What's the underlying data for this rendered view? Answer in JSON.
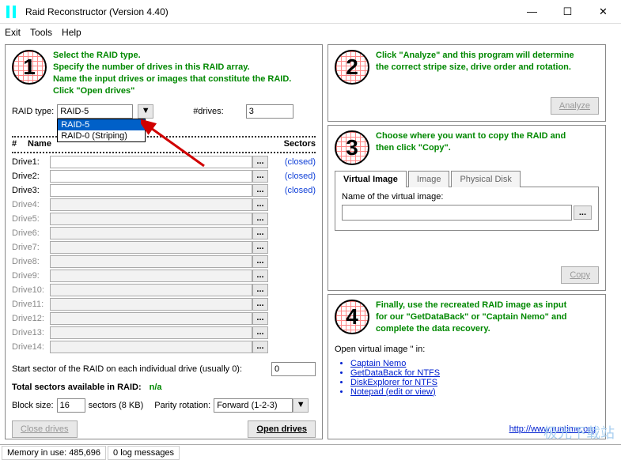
{
  "window": {
    "title": "Raid Reconstructor (Version 4.40)",
    "min": "—",
    "max": "☐",
    "close": "✕"
  },
  "menu": {
    "exit": "Exit",
    "tools": "Tools",
    "help": "Help"
  },
  "step1": {
    "num": "1",
    "line1": "Select the RAID type.",
    "line2": "Specify the number of drives in this RAID array.",
    "line3": "Name the input drives or images that constitute the RAID.",
    "line4": "Click \"Open drives\""
  },
  "raidtype_label": "RAID type:",
  "raidtype_value": "RAID-5",
  "raidtype_options": {
    "opt1": "RAID-5",
    "opt2": "RAID-0 (Striping)"
  },
  "drives_label": "#drives:",
  "drives_value": "3",
  "table": {
    "col_num": "#",
    "col_name": "Name",
    "col_sectors": "Sectors",
    "rows": [
      {
        "label": "Drive1:",
        "status": "(closed)",
        "en": true
      },
      {
        "label": "Drive2:",
        "status": "(closed)",
        "en": true
      },
      {
        "label": "Drive3:",
        "status": "(closed)",
        "en": true
      },
      {
        "label": "Drive4:",
        "status": "",
        "en": false
      },
      {
        "label": "Drive5:",
        "status": "",
        "en": false
      },
      {
        "label": "Drive6:",
        "status": "",
        "en": false
      },
      {
        "label": "Drive7:",
        "status": "",
        "en": false
      },
      {
        "label": "Drive8:",
        "status": "",
        "en": false
      },
      {
        "label": "Drive9:",
        "status": "",
        "en": false
      },
      {
        "label": "Drive10:",
        "status": "",
        "en": false
      },
      {
        "label": "Drive11:",
        "status": "",
        "en": false
      },
      {
        "label": "Drive12:",
        "status": "",
        "en": false
      },
      {
        "label": "Drive13:",
        "status": "",
        "en": false
      },
      {
        "label": "Drive14:",
        "status": "",
        "en": false
      }
    ]
  },
  "start_sector_label": "Start sector of the RAID on each individual drive (usually 0):",
  "start_sector_value": "0",
  "total_sectors_label": "Total sectors available in RAID:",
  "total_sectors_value": "n/a",
  "blocksize_label": "Block size:",
  "blocksize_value": "16",
  "blocksize_suffix": "sectors (8 KB)",
  "parity_label": "Parity rotation:",
  "parity_value": "Forward (1-2-3)",
  "close_drives_btn": "Close drives",
  "open_drives_btn": "Open drives",
  "step2": {
    "num": "2",
    "line1": "Click \"Analyze\" and this program will determine",
    "line2": "the correct stripe size, drive order and rotation."
  },
  "analyze_btn": "Analyze",
  "step3": {
    "num": "3",
    "line1": "Choose where you want to copy the RAID and",
    "line2": "then click \"Copy\"."
  },
  "tabs": {
    "virtual": "Virtual Image",
    "image": "Image",
    "physical": "Physical Disk"
  },
  "name_virtual_label": "Name of the virtual image:",
  "name_virtual_value": "",
  "browse_btn": "...",
  "copy_btn": "Copy",
  "step4": {
    "num": "4",
    "line1": "Finally, use the recreated RAID image as input",
    "line2": "for our \"GetDataBack\" or \"Captain Nemo\" and",
    "line3": "complete the data recovery."
  },
  "open_in_label": "Open virtual image '' in:",
  "links": {
    "l1": "Captain Nemo",
    "l2": "GetDataBack for NTFS",
    "l3": "DiskExplorer for NTFS",
    "l4": "Notepad (edit or view)"
  },
  "runtime_url": "http://www.runtime.org",
  "status": {
    "mem": "Memory in use: 485,696",
    "log": "0 log messages"
  },
  "watermark": "极光下载站"
}
